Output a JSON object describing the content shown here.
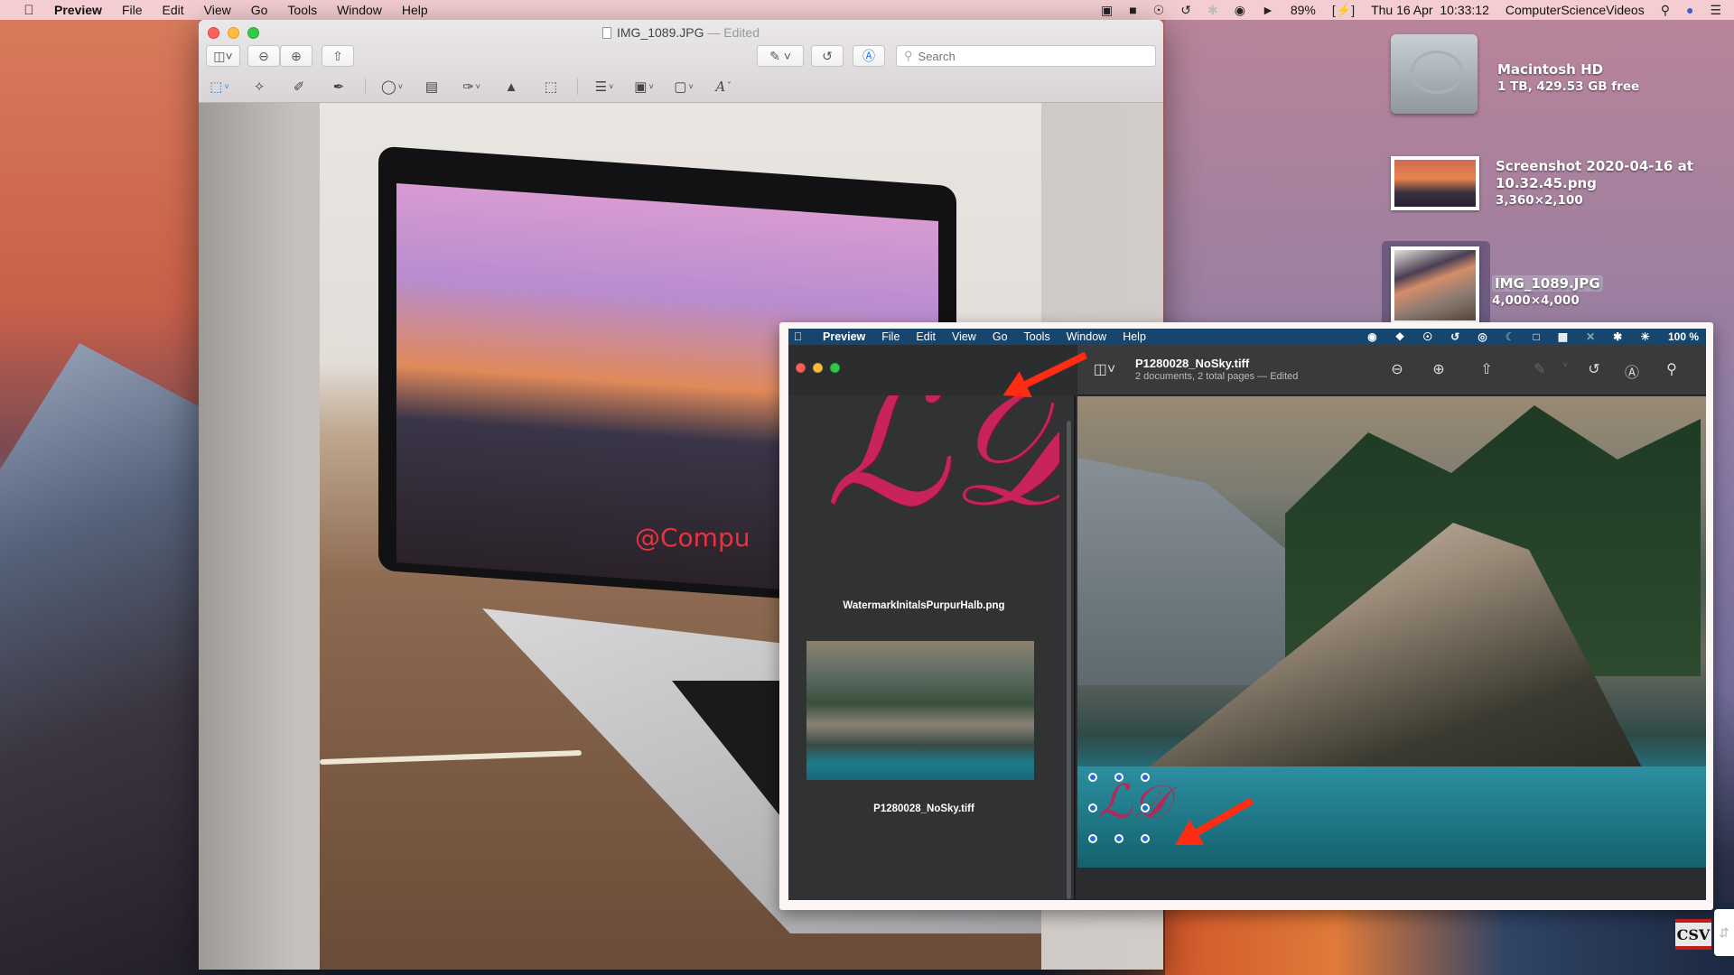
{
  "menubar": {
    "app_name": "Preview",
    "items": [
      "File",
      "Edit",
      "View",
      "Go",
      "Tools",
      "Window",
      "Help"
    ],
    "status_icons": [
      "camera-record-icon",
      "display-icon",
      "accessibility-icon",
      "time-machine-icon",
      "bluetooth-icon",
      "wifi-icon",
      "volume-icon"
    ],
    "battery": "89%",
    "datetime": "Thu 16 Apr  10:33:12",
    "user": "ComputerScienceVideos"
  },
  "preview_window": {
    "title": "IMG_1089.JPG",
    "title_suffix": "— Edited",
    "search_placeholder": "Search",
    "toolbar_icons": [
      "sidebar-toggle-icon",
      "zoom-out-icon",
      "zoom-in-icon",
      "share-icon",
      "highlight-pen-icon",
      "rotate-icon",
      "markup-icon"
    ],
    "markup_icons": [
      "rectangular-selection-icon",
      "instant-alpha-icon",
      "sketch-icon",
      "draw-icon",
      "shapes-icon",
      "text-icon",
      "sign-icon",
      "adjust-color-icon",
      "adjust-size-icon",
      "shape-style-icon",
      "border-color-icon",
      "fill-color-icon",
      "text-style-icon"
    ],
    "photo_watermark": "@Compu"
  },
  "desktop": {
    "items": [
      {
        "name": "Macintosh HD",
        "detail": "1 TB, 429.53 GB free"
      },
      {
        "name": "Screenshot 2020-04-16 at 10.32.45.png",
        "name_line1": "Screenshot 2020-04-16 at",
        "name_line2": "10.32.45.png",
        "detail": "3,360×2,100"
      },
      {
        "name": "IMG_1089.JPG",
        "detail": "4,000×4,000",
        "selected": true
      }
    ]
  },
  "overlay": {
    "menubar": {
      "app_name": "Preview",
      "items": [
        "File",
        "Edit",
        "View",
        "Go",
        "Tools",
        "Window",
        "Help"
      ],
      "battery": "100 %"
    },
    "window": {
      "title": "P1280028_NoSky.tiff",
      "subtitle": "2 documents, 2 total pages — Edited",
      "sidebar_items": [
        {
          "label": "WatermarkInitalsPurpurHalb.png",
          "glyph": "ℒ𝒟"
        },
        {
          "label": "P1280028_NoSky.tiff"
        }
      ],
      "toolbar_icons": [
        "zoom-out-icon",
        "zoom-in-icon",
        "share-icon",
        "markup-pen-icon",
        "rotate-icon",
        "markup-icon",
        "search-icon"
      ],
      "selection_glyph": "ℒ𝒟"
    }
  },
  "branding": {
    "badge": "CSV"
  },
  "colors": {
    "arrow": "#ff2b12",
    "watermark": "#c8245a",
    "selection_handle": "#1d6fd0"
  }
}
